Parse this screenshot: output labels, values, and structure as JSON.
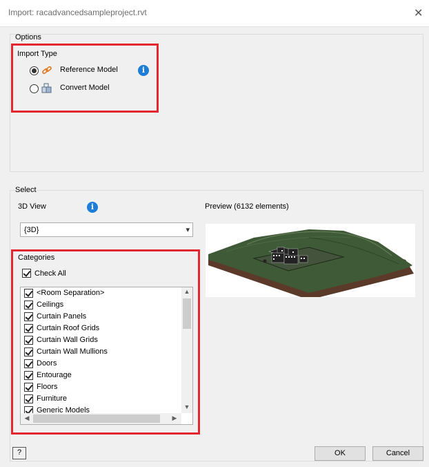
{
  "window": {
    "title": "Import:  racadvancedsampleproject.rvt",
    "close_glyph": "✕"
  },
  "options": {
    "legend": "Options",
    "import_type": {
      "label": "Import Type",
      "choices": [
        {
          "label": "Reference Model",
          "selected": true,
          "icon": "link-icon"
        },
        {
          "label": "Convert Model",
          "selected": false,
          "icon": "cube-icon"
        }
      ],
      "info_glyph": "i"
    }
  },
  "select": {
    "legend": "Select",
    "view_label": "3D View",
    "view_value": "{3D}",
    "info_glyph": "i",
    "preview_label": "Preview (6132 elements)"
  },
  "categories": {
    "label": "Categories",
    "check_all_label": "Check All",
    "check_all": true,
    "items": [
      {
        "label": "<Room Separation>",
        "checked": true
      },
      {
        "label": "Ceilings",
        "checked": true
      },
      {
        "label": "Curtain Panels",
        "checked": true
      },
      {
        "label": "Curtain Roof Grids",
        "checked": true
      },
      {
        "label": "Curtain Wall Grids",
        "checked": true
      },
      {
        "label": "Curtain Wall Mullions",
        "checked": true
      },
      {
        "label": "Doors",
        "checked": true
      },
      {
        "label": "Entourage",
        "checked": true
      },
      {
        "label": "Floors",
        "checked": true
      },
      {
        "label": "Furniture",
        "checked": true
      },
      {
        "label": "Generic Models",
        "checked": true
      }
    ]
  },
  "footer": {
    "help_glyph": "?",
    "ok_label": "OK",
    "cancel_label": "Cancel"
  },
  "colors": {
    "highlight": "#e3262f",
    "info": "#1d7dd7",
    "dialog_bg": "#f0f0f0"
  }
}
